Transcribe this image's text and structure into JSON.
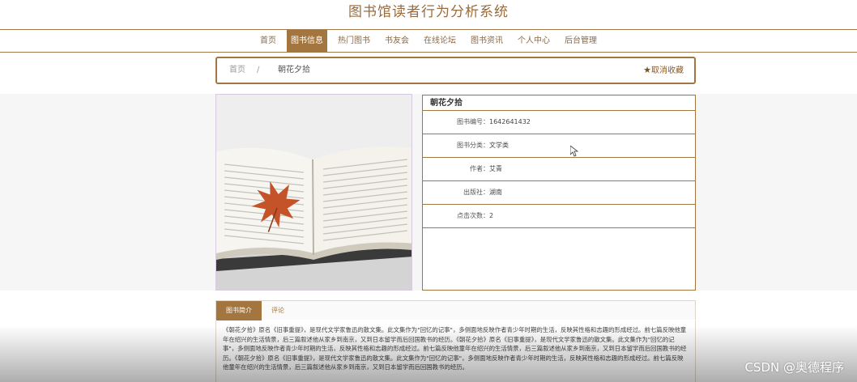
{
  "site": {
    "title": "图书馆读者行为分析系统"
  },
  "nav": {
    "items": [
      {
        "label": "首页",
        "active": false
      },
      {
        "label": "图书信息",
        "active": true
      },
      {
        "label": "热门图书",
        "active": false
      },
      {
        "label": "书友会",
        "active": false
      },
      {
        "label": "在线论坛",
        "active": false
      },
      {
        "label": "图书资讯",
        "active": false
      },
      {
        "label": "个人中心",
        "active": false
      },
      {
        "label": "后台管理",
        "active": false
      }
    ]
  },
  "breadcrumb": {
    "home": "首页",
    "separator": "/",
    "current": "朝花夕拾",
    "favorite_label": "取消收藏",
    "favorite_icon": "star-icon"
  },
  "book": {
    "title": "朝花夕拾",
    "image_icon": "open-book-with-maple-leaf",
    "fields": [
      {
        "label": "图书编号：",
        "value": "1642641432"
      },
      {
        "label": "图书分类：",
        "value": "文学类"
      },
      {
        "label": "作者：",
        "value": "艾青"
      },
      {
        "label": "出版社：",
        "value": "湖南"
      },
      {
        "label": "点击次数：",
        "value": "2"
      }
    ]
  },
  "tabs": {
    "items": [
      {
        "label": "图书简介",
        "active": true
      },
      {
        "label": "评论",
        "active": false
      }
    ]
  },
  "description": {
    "text": "《朝花夕拾》原名《旧事重提》，是现代文学家鲁迅的散文集。此文集作为\"回忆的记事\"，多侧面地反映作者青少年时期的生活，反映其性格和志趣的形成经过。前七篇反映他童年在绍兴的生活情景，后三篇叙述他从家乡到南京，又到日本留学而后回国教书的经历。《朝花夕拾》原名《旧事重提》，是现代文学家鲁迅的散文集。此文集作为\"回忆的记事\"，多侧面地反映作者青少年时期的生活，反映其性格和志趣的形成经过。前七篇反映他童年在绍兴的生活情景，后三篇叙述他从家乡到南京，又到日本留学而后回国教书的经历。《朝花夕拾》原名《旧事重提》，是现代文学家鲁迅的散文集。此文集作为\"回忆的记事\"，多侧面地反映作者青少年时期的生活，反映其性格和志趣的形成经过。前七篇反映他童年在绍兴的生活情景，后三篇叙述他从家乡到南京，又到日本留学而后回国教书的经历。"
  },
  "watermark": {
    "text": "CSDN @奥德程序"
  },
  "colors": {
    "accent": "#a3763f",
    "title": "#9a6b3a"
  }
}
